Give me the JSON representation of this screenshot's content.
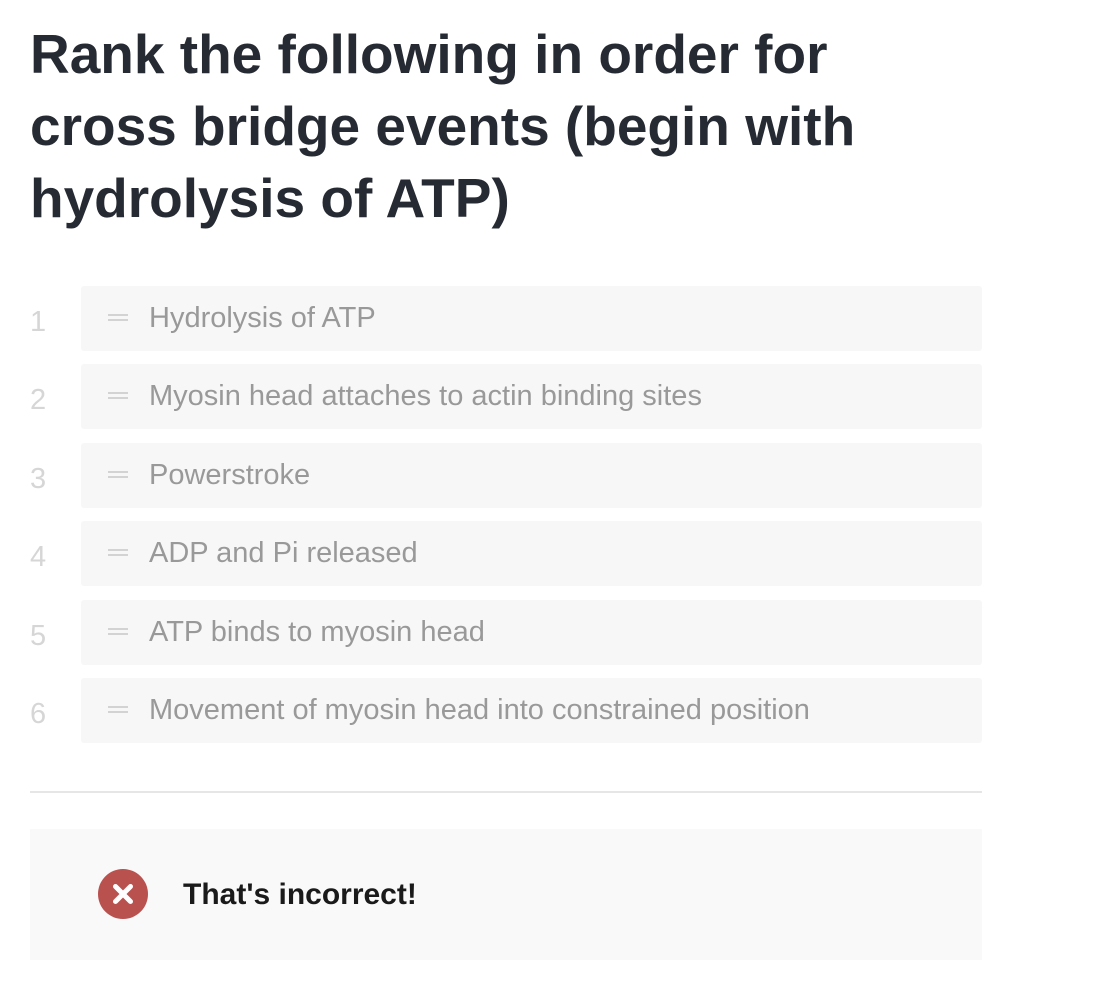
{
  "question": {
    "title": "Rank the following in order for cross bridge events (begin with hydrolysis of ATP)"
  },
  "ranking": {
    "items": [
      {
        "number": "1",
        "label": "Hydrolysis of ATP"
      },
      {
        "number": "2",
        "label": "Myosin head attaches to actin binding sites"
      },
      {
        "number": "3",
        "label": "Powerstroke"
      },
      {
        "number": "4",
        "label": "ADP and Pi released"
      },
      {
        "number": "5",
        "label": "ATP binds to myosin head"
      },
      {
        "number": "6",
        "label": "Movement of myosin head into constrained position"
      }
    ],
    "handle_icon": "drag-handle-icon"
  },
  "feedback": {
    "icon": "x-circle-icon",
    "icon_color": "#b9514f",
    "text": "That's incorrect!"
  }
}
